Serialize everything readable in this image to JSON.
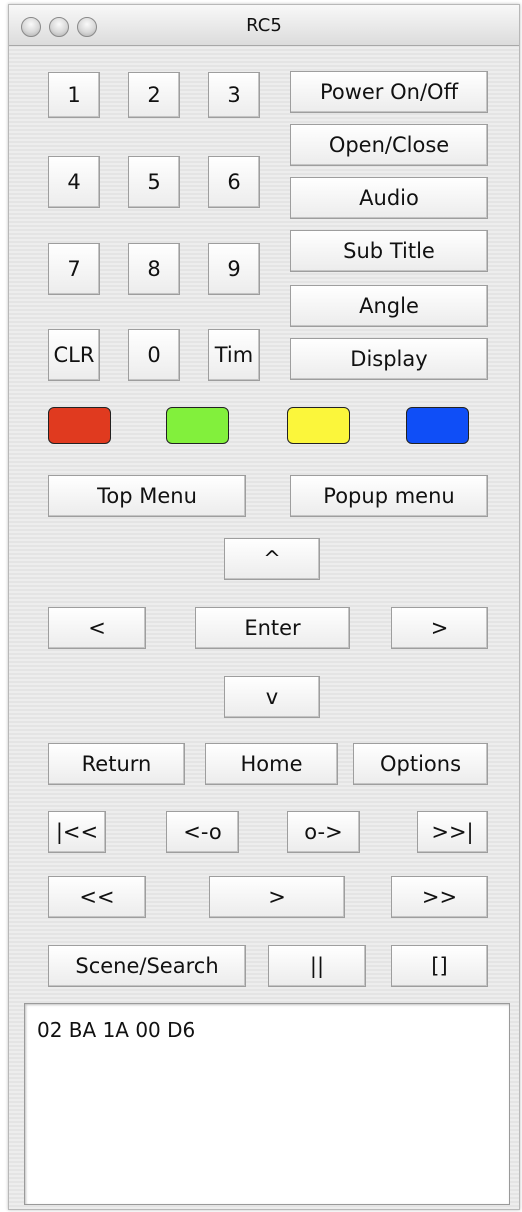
{
  "window": {
    "title": "RC5"
  },
  "keypad": {
    "k1": "1",
    "k2": "2",
    "k3": "3",
    "k4": "4",
    "k5": "5",
    "k6": "6",
    "k7": "7",
    "k8": "8",
    "k9": "9",
    "clr": "CLR",
    "k0": "0",
    "tim": "Tim"
  },
  "functions": {
    "power": "Power On/Off",
    "open_close": "Open/Close",
    "audio": "Audio",
    "subtitle": "Sub Title",
    "angle": "Angle",
    "display": "Display"
  },
  "color_keys": {
    "red": "#e03a1f",
    "green": "#82f03c",
    "yellow": "#fbf63b",
    "blue": "#0f4ef7"
  },
  "menus": {
    "top_menu": "Top Menu",
    "popup_menu": "Popup menu"
  },
  "navigation": {
    "up": "^",
    "left": "<",
    "enter": "Enter",
    "right": ">",
    "down": "v"
  },
  "system": {
    "return": "Return",
    "home": "Home",
    "options": "Options"
  },
  "transport": {
    "prev": "|<<",
    "step_back": "<-o",
    "step_fwd": "o->",
    "next": ">>|",
    "rewind": "<<",
    "play": ">",
    "fast_forward": ">>",
    "scene_search": "Scene/Search",
    "pause": "||",
    "stop": "[]"
  },
  "output": {
    "text": "02 BA 1A 00 D6"
  }
}
